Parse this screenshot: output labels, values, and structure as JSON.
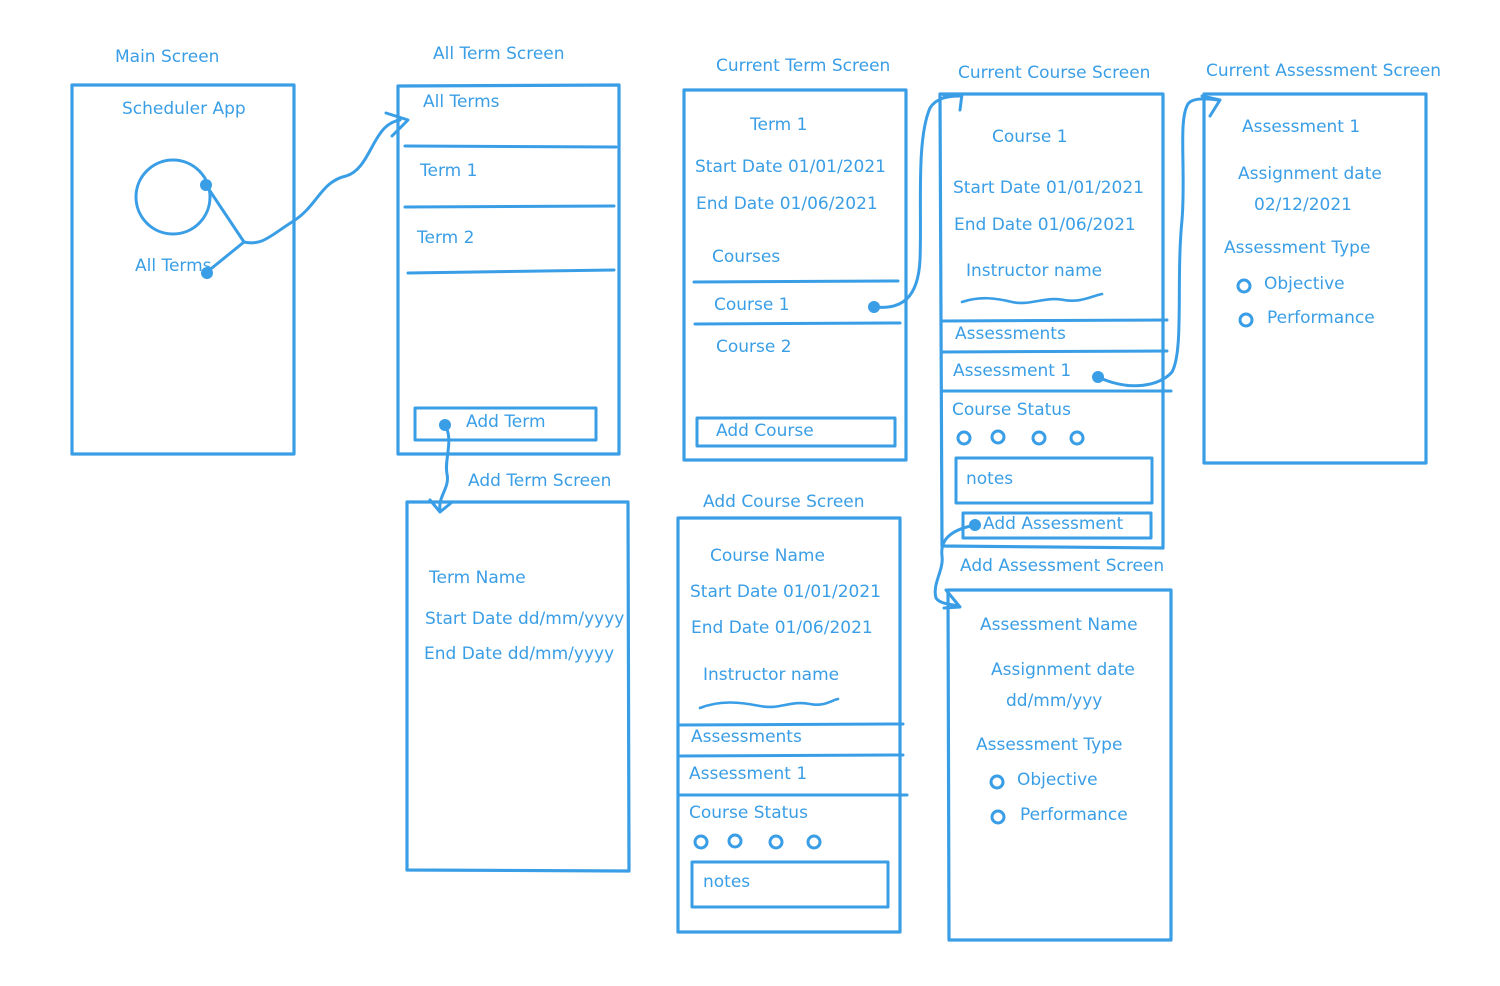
{
  "colors": {
    "ink": "#3a9ee6",
    "background": "#ffffff"
  },
  "main": {
    "title": "Main Screen",
    "app_name": "Scheduler App",
    "all_terms": "All Terms"
  },
  "all_terms": {
    "title": "All Term Screen",
    "header": "All Terms",
    "items": [
      "Term 1",
      "Term 2"
    ],
    "add_button": "Add Term"
  },
  "add_term": {
    "title": "Add Term Screen",
    "name": "Term Name",
    "start": "Start Date dd/mm/yyyy",
    "end": "End Date dd/mm/yyyy"
  },
  "current_term": {
    "title": "Current Term Screen",
    "name": "Term 1",
    "start": "Start Date 01/01/2021",
    "end": "End Date 01/06/2021",
    "courses_label": "Courses",
    "courses": [
      "Course 1",
      "Course 2"
    ],
    "add_button": "Add Course"
  },
  "add_course": {
    "title": "Add Course Screen",
    "name": "Course Name",
    "start": "Start Date 01/01/2021",
    "end": "End Date 01/06/2021",
    "instructor": "Instructor name",
    "assessments_label": "Assessments",
    "assessment_1": "Assessment 1",
    "status_label": "Course Status",
    "notes": "notes"
  },
  "current_course": {
    "title": "Current Course Screen",
    "name": "Course 1",
    "start": "Start Date 01/01/2021",
    "end": "End Date 01/06/2021",
    "instructor": "Instructor name",
    "assessments_label": "Assessments",
    "assessment_1": "Assessment 1",
    "status_label": "Course Status",
    "notes": "notes",
    "add_button": "Add Assessment"
  },
  "add_assessment": {
    "title": "Add Assessment Screen",
    "name": "Assessment Name",
    "date_label": "Assignment date",
    "date_value": "dd/mm/yyy",
    "type_label": "Assessment Type",
    "options": [
      "Objective",
      "Performance"
    ]
  },
  "current_assessment": {
    "title": "Current Assessment Screen",
    "name": "Assessment 1",
    "date_label": "Assignment date",
    "date_value": "02/12/2021",
    "type_label": "Assessment Type",
    "options": [
      "Objective",
      "Performance"
    ]
  }
}
